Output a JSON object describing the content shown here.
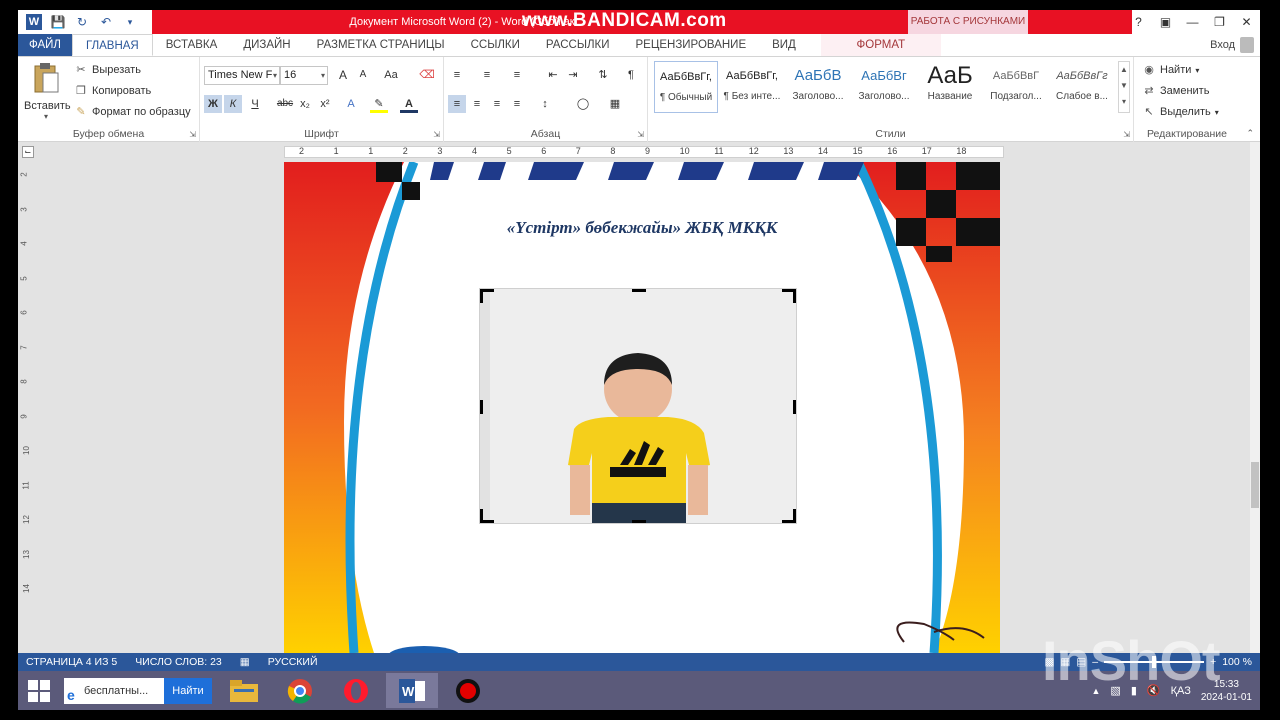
{
  "titlebar": {
    "document_title": "Документ Microsoft Word (2) - Word (Сбой ак",
    "watermark": "www.BANDICAM.com",
    "contextual_header": "РАБОТА С РИСУНКАМИ",
    "help": "?",
    "window_controls": [
      "restore-ribbon-icon",
      "minimize-icon",
      "maximize-icon",
      "close-icon"
    ]
  },
  "tabs": {
    "file": "ФАЙЛ",
    "items": [
      "ГЛАВНАЯ",
      "ВСТАВКА",
      "ДИЗАЙН",
      "РАЗМЕТКА СТРАНИЦЫ",
      "ССЫЛКИ",
      "РАССЫЛКИ",
      "РЕЦЕНЗИРОВАНИЕ",
      "ВИД"
    ],
    "contextual": "ФОРМАТ",
    "signin": "Вход"
  },
  "ribbon": {
    "clipboard": {
      "label": "Буфер обмена",
      "paste": "Вставить",
      "cut": "Вырезать",
      "copy": "Копировать",
      "format_painter": "Формат по образцу"
    },
    "font": {
      "label": "Шрифт",
      "font_name": "Times New F",
      "font_size": "16",
      "bold": "Ж",
      "italic": "К",
      "underline": "Ч",
      "strike": "abc",
      "subscript": "x₂",
      "superscript": "x²",
      "grow": "A",
      "shrink": "A",
      "case": "Aa"
    },
    "paragraph": {
      "label": "Абзац"
    },
    "styles": {
      "label": "Стили",
      "items": [
        {
          "sample": "АаБбВвГг,",
          "name": "¶ Обычный"
        },
        {
          "sample": "АаБбВвГг,",
          "name": "¶ Без инте..."
        },
        {
          "sample": "АаБбВ",
          "name": "Заголово..."
        },
        {
          "sample": "АаБбВг",
          "name": "Заголово..."
        },
        {
          "sample": "АаБ",
          "name": "Название"
        },
        {
          "sample": "АаБбВвГ",
          "name": "Подзагол..."
        },
        {
          "sample": "АаБбВвГг",
          "name": "Слабое в..."
        }
      ]
    },
    "editing": {
      "label": "Редактирование",
      "find": "Найти",
      "replace": "Заменить",
      "select": "Выделить"
    }
  },
  "ruler": {
    "h_ticks": [
      "2",
      "1",
      "1",
      "2",
      "3",
      "4",
      "5",
      "6",
      "7",
      "8",
      "9",
      "10",
      "11",
      "12",
      "13",
      "14",
      "15",
      "16",
      "17",
      "18"
    ],
    "v_ticks": [
      "2",
      "3",
      "4",
      "5",
      "6",
      "7",
      "8",
      "9",
      "10",
      "11",
      "12",
      "13",
      "14"
    ]
  },
  "page": {
    "org_name": "«Үстірт» бөбекжайы»  ЖБҚ МКҚК",
    "colors": {
      "red": "#e21e1e",
      "orange": "#f58220",
      "yellow": "#ffd100",
      "blue": "#1b9ad6",
      "title_navy": "#1f3864"
    }
  },
  "statusbar": {
    "page": "СТРАНИЦА 4 ИЗ 5",
    "words": "ЧИСЛО СЛОВ: 23",
    "language": "РУССКИЙ",
    "zoom": "100 %"
  },
  "taskbar": {
    "search_text": "бесплатны...",
    "search_button": "Найти",
    "language": "ҚАЗ",
    "time": "15:33",
    "date": "2024-01-01"
  },
  "overlay": {
    "inshot": "InShOt"
  }
}
